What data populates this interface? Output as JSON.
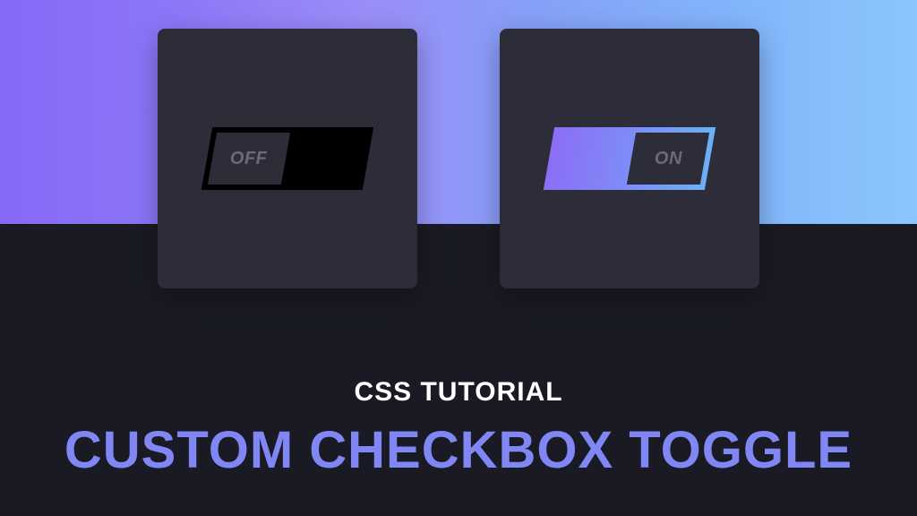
{
  "toggle_off": {
    "label": "OFF"
  },
  "toggle_on": {
    "label": "ON"
  },
  "subtitle": "CSS TUTORIAL",
  "main_title": "CUSTOM CHECKBOX TOGGLE"
}
